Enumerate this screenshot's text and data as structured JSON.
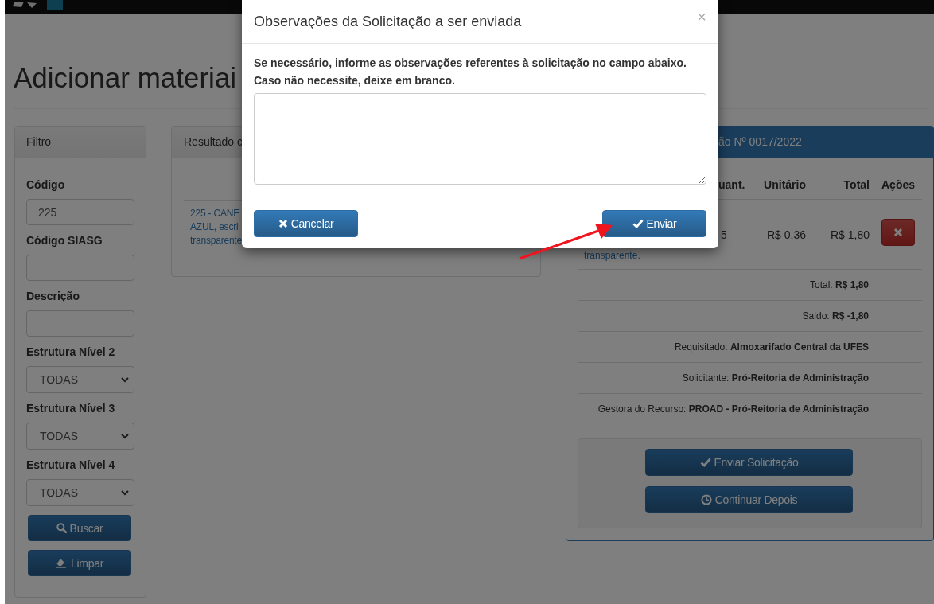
{
  "page_title": "Adicionar materiai",
  "filter_panel": {
    "title": "Filtro",
    "fields": [
      {
        "kind": "text",
        "label": "Código",
        "value": "225"
      },
      {
        "kind": "text",
        "label": "Código SIASG"
      },
      {
        "kind": "text",
        "label": "Descrição"
      },
      {
        "kind": "select",
        "label": "Estrutura Nível 2",
        "value": "TODAS"
      },
      {
        "kind": "select",
        "label": "Estrutura Nível 3",
        "value": "TODAS"
      },
      {
        "kind": "select",
        "label": "Estrutura Nível 4",
        "value": "TODAS"
      }
    ],
    "buttons": [
      "Buscar",
      "Limpar"
    ]
  },
  "results_panel": {
    "title": "Resultado c",
    "item_lines": [
      "225 - CANE",
      "AZUL, escri",
      "transparente"
    ]
  },
  "request_panel": {
    "title": "ão Nº 0017/2022",
    "columns": [
      "uant.",
      "Unitário",
      "Total",
      "Ações"
    ],
    "items": [
      {
        "description": "transparente.",
        "quantity": "5",
        "unit_price": "R$ 0,36",
        "total": "R$ 1,80"
      }
    ],
    "summary": [
      "Total: **R$ 1,80**",
      "Saldo: **R$ -1,80**",
      "Requisitado: **Almoxarifado Central da UFES**",
      "Solicitante: **Pró-Reitoria de Administração**",
      "Gestora do Recurso: **PROAD - Pró-Reitoria de Administração**"
    ],
    "buttons": [
      "Enviar Solicitação",
      "Continuar Depois"
    ]
  },
  "modal": {
    "title": "Observações da Solicitação a ser enviada",
    "close": "×",
    "message": [
      "Se necessário, informe as observações referentes à solicitação no campo abaixo.",
      "Caso não necessite, deixe em branco."
    ],
    "buttons": [
      "Cancelar",
      "Enviar"
    ]
  }
}
